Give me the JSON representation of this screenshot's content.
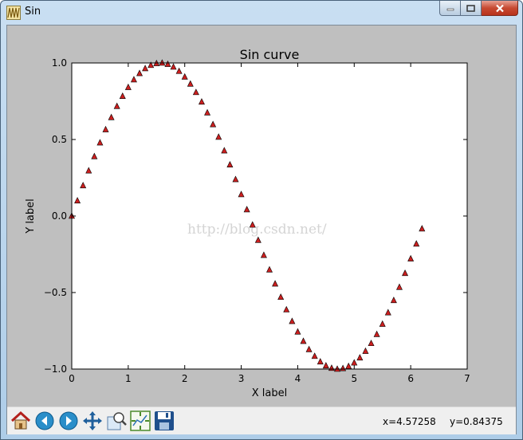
{
  "window": {
    "title": "Sin",
    "app_icon": "matplotlib-icon",
    "buttons": [
      "minimize-icon",
      "maximize-icon",
      "close-icon"
    ]
  },
  "watermark": "http://blog.csdn.net/",
  "toolbar": {
    "tools": [
      "home-icon",
      "back-arrow-icon",
      "forward-arrow-icon",
      "pan-move-icon",
      "zoom-rect-icon",
      "configure-subplots-icon",
      "save-floppy-icon"
    ],
    "x_readout": "x=4.57258",
    "y_readout": "y=0.84375"
  },
  "chart_data": {
    "type": "scatter",
    "title": "Sin curve",
    "xlabel": "X label",
    "ylabel": "Y label",
    "xlim": [
      0,
      7
    ],
    "ylim": [
      -1.0,
      1.0
    ],
    "xticks": [
      "0",
      "1",
      "2",
      "3",
      "4",
      "5",
      "6",
      "7"
    ],
    "yticks": [
      "1.0",
      "0.5",
      "0.0",
      "−0.5",
      "−1.0"
    ],
    "grid": false,
    "marker": "triangle",
    "marker_color": "#cc1f1f",
    "series": [
      {
        "x": [
          0.0,
          0.1,
          0.2,
          0.3,
          0.4,
          0.5,
          0.6,
          0.7,
          0.8,
          0.9,
          1.0,
          1.1,
          1.2,
          1.3,
          1.4,
          1.5,
          1.6,
          1.7,
          1.8,
          1.9,
          2.0,
          2.1,
          2.2,
          2.3,
          2.4,
          2.5,
          2.6,
          2.7,
          2.8,
          2.9,
          3.0,
          3.1,
          3.2,
          3.3,
          3.4,
          3.5,
          3.6,
          3.7,
          3.8,
          3.9,
          4.0,
          4.1,
          4.2,
          4.3,
          4.4,
          4.5,
          4.6,
          4.7,
          4.8,
          4.9,
          5.0,
          5.1,
          5.2,
          5.3,
          5.4,
          5.5,
          5.6,
          5.7,
          5.8,
          5.9,
          6.0,
          6.1,
          6.2
        ],
        "y": [
          0.0,
          0.1,
          0.199,
          0.296,
          0.389,
          0.479,
          0.565,
          0.644,
          0.717,
          0.783,
          0.841,
          0.891,
          0.932,
          0.964,
          0.985,
          0.997,
          1.0,
          0.992,
          0.974,
          0.946,
          0.909,
          0.863,
          0.808,
          0.746,
          0.675,
          0.598,
          0.516,
          0.427,
          0.335,
          0.239,
          0.141,
          0.042,
          -0.058,
          -0.158,
          -0.256,
          -0.351,
          -0.443,
          -0.53,
          -0.612,
          -0.688,
          -0.757,
          -0.818,
          -0.872,
          -0.916,
          -0.952,
          -0.978,
          -0.994,
          -1.0,
          -0.996,
          -0.982,
          -0.959,
          -0.926,
          -0.883,
          -0.832,
          -0.773,
          -0.706,
          -0.631,
          -0.551,
          -0.465,
          -0.374,
          -0.279,
          -0.182,
          -0.083
        ]
      }
    ]
  }
}
